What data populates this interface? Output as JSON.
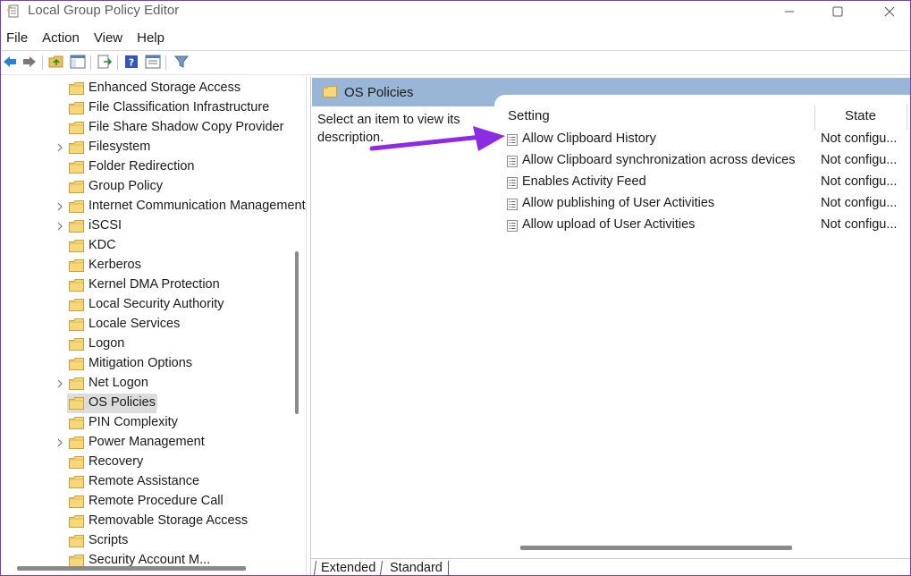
{
  "window": {
    "title": "Local Group Policy Editor",
    "accent_border": "#7a3fb5"
  },
  "menu": {
    "items": [
      "File",
      "Action",
      "View",
      "Help"
    ]
  },
  "toolbar": {
    "buttons": [
      "back-icon",
      "forward-icon",
      "up-folder-icon",
      "show-hide-console-tree-icon",
      "export-list-icon",
      "help-icon",
      "properties-icon",
      "filter-icon"
    ]
  },
  "tree": {
    "items": [
      {
        "label": "Enhanced Storage Access",
        "expandable": false
      },
      {
        "label": "File Classification Infrastructure",
        "expandable": false
      },
      {
        "label": "File Share Shadow Copy Provider",
        "expandable": false
      },
      {
        "label": "Filesystem",
        "expandable": true
      },
      {
        "label": "Folder Redirection",
        "expandable": false
      },
      {
        "label": "Group Policy",
        "expandable": false
      },
      {
        "label": "Internet Communication Management",
        "expandable": true
      },
      {
        "label": "iSCSI",
        "expandable": true
      },
      {
        "label": "KDC",
        "expandable": false
      },
      {
        "label": "Kerberos",
        "expandable": false
      },
      {
        "label": "Kernel DMA Protection",
        "expandable": false
      },
      {
        "label": "Local Security Authority",
        "expandable": false
      },
      {
        "label": "Locale Services",
        "expandable": false
      },
      {
        "label": "Logon",
        "expandable": false
      },
      {
        "label": "Mitigation Options",
        "expandable": false
      },
      {
        "label": "Net Logon",
        "expandable": true
      },
      {
        "label": "OS Policies",
        "expandable": false,
        "selected": true
      },
      {
        "label": "PIN Complexity",
        "expandable": false
      },
      {
        "label": "Power Management",
        "expandable": true
      },
      {
        "label": "Recovery",
        "expandable": false
      },
      {
        "label": "Remote Assistance",
        "expandable": false
      },
      {
        "label": "Remote Procedure Call",
        "expandable": false
      },
      {
        "label": "Removable Storage Access",
        "expandable": false
      },
      {
        "label": "Scripts",
        "expandable": false
      },
      {
        "label": "Security Account M...",
        "expandable": false
      }
    ]
  },
  "right": {
    "header_title": "OS Policies",
    "description": "Select an item to view its description.",
    "columns": {
      "setting": "Setting",
      "state": "State"
    },
    "rows": [
      {
        "name": "Allow Clipboard History",
        "state": "Not configu..."
      },
      {
        "name": "Allow Clipboard synchronization across devices",
        "state": "Not configu..."
      },
      {
        "name": "Enables Activity Feed",
        "state": "Not configu..."
      },
      {
        "name": "Allow publishing of User Activities",
        "state": "Not configu..."
      },
      {
        "name": "Allow upload of User Activities",
        "state": "Not configu..."
      }
    ],
    "tabs": [
      "Extended",
      "Standard"
    ],
    "annotation_arrow_color": "#8b2be2"
  }
}
